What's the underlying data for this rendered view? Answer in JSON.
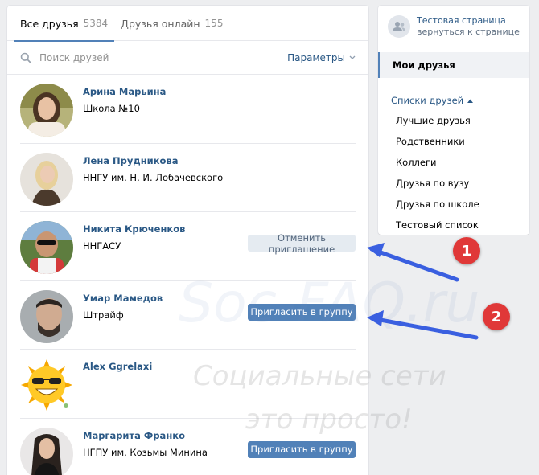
{
  "tabs": [
    {
      "label": "Все друзья",
      "count": "5384"
    },
    {
      "label": "Друзья онлайн",
      "count": "155"
    }
  ],
  "search": {
    "placeholder": "Поиск друзей",
    "params_label": "Параметры"
  },
  "friends": [
    {
      "name": "Арина Марьина",
      "sub": "Школа №10",
      "button": ""
    },
    {
      "name": "Лена Прудникова",
      "sub": "ННГУ им. Н. И. Лобачевского",
      "button": ""
    },
    {
      "name": "Никита Крюченков",
      "sub": "ННГАСУ",
      "button": "Отменить приглашение"
    },
    {
      "name": "Умар Мамедов",
      "sub": "Штрайф",
      "button": "Пригласить в группу"
    },
    {
      "name": "Alex Ggrelaxi",
      "sub": "",
      "button": ""
    },
    {
      "name": "Маргарита Франко",
      "sub": "НГПУ им. Козьмы Минина",
      "button": "Пригласить в группу"
    }
  ],
  "side": {
    "page_title": "Тестовая страница",
    "page_back": "вернуться к странице",
    "my_friends": "Мои друзья",
    "lists_header": "Списки друзей",
    "lists": [
      "Лучшие друзья",
      "Родственники",
      "Коллеги",
      "Друзья по вузу",
      "Друзья по школе",
      "Тестовый список"
    ]
  },
  "annotations": {
    "badge1": "1",
    "badge2": "2",
    "watermark_site": "Soc-FAQ.ru",
    "watermark_line1": "Социальные сети",
    "watermark_line2": "это просто!"
  },
  "colors": {
    "accent": "#5181b8",
    "link": "#2a5885",
    "badge": "#e03838",
    "arrow": "#3a5fe0"
  }
}
